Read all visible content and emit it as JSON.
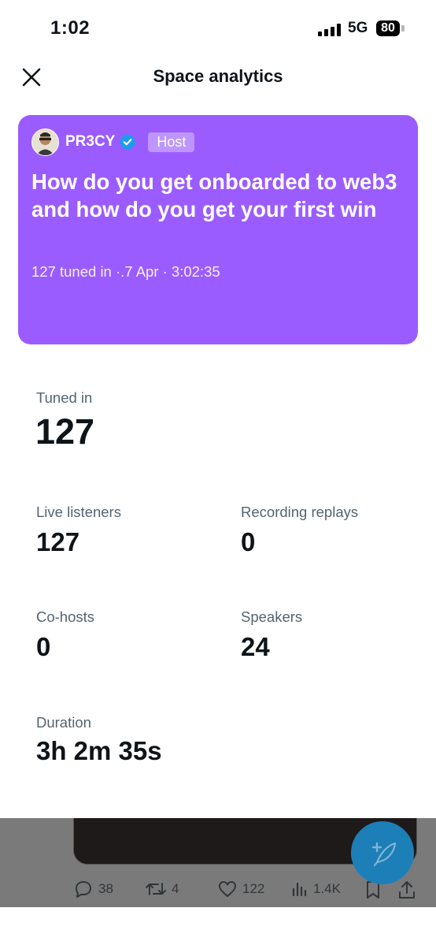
{
  "status_bar": {
    "time": "1:02",
    "network": "5G",
    "battery": "80"
  },
  "header": {
    "title": "Space analytics",
    "close_icon": "close-icon"
  },
  "space_card": {
    "background": "#9b5cff",
    "host_name": "PR3CY",
    "host_badge": "Host",
    "title": "How do you get onboarded to web3 and how do you get your first win",
    "meta": "127 tuned in ·.7 Apr · 3:02:35"
  },
  "stats": {
    "tuned_in": {
      "label": "Tuned in",
      "value": "127"
    },
    "live_listeners": {
      "label": "Live listeners",
      "value": "127"
    },
    "recording_replays": {
      "label": "Recording replays",
      "value": "0"
    },
    "co_hosts": {
      "label": "Co-hosts",
      "value": "0"
    },
    "speakers": {
      "label": "Speakers",
      "value": "24"
    },
    "duration": {
      "label": "Duration",
      "value": "3h 2m 35s"
    }
  },
  "tweet_actions": {
    "replies": "38",
    "retweets": "4",
    "likes": "122",
    "views": "1.4K"
  }
}
